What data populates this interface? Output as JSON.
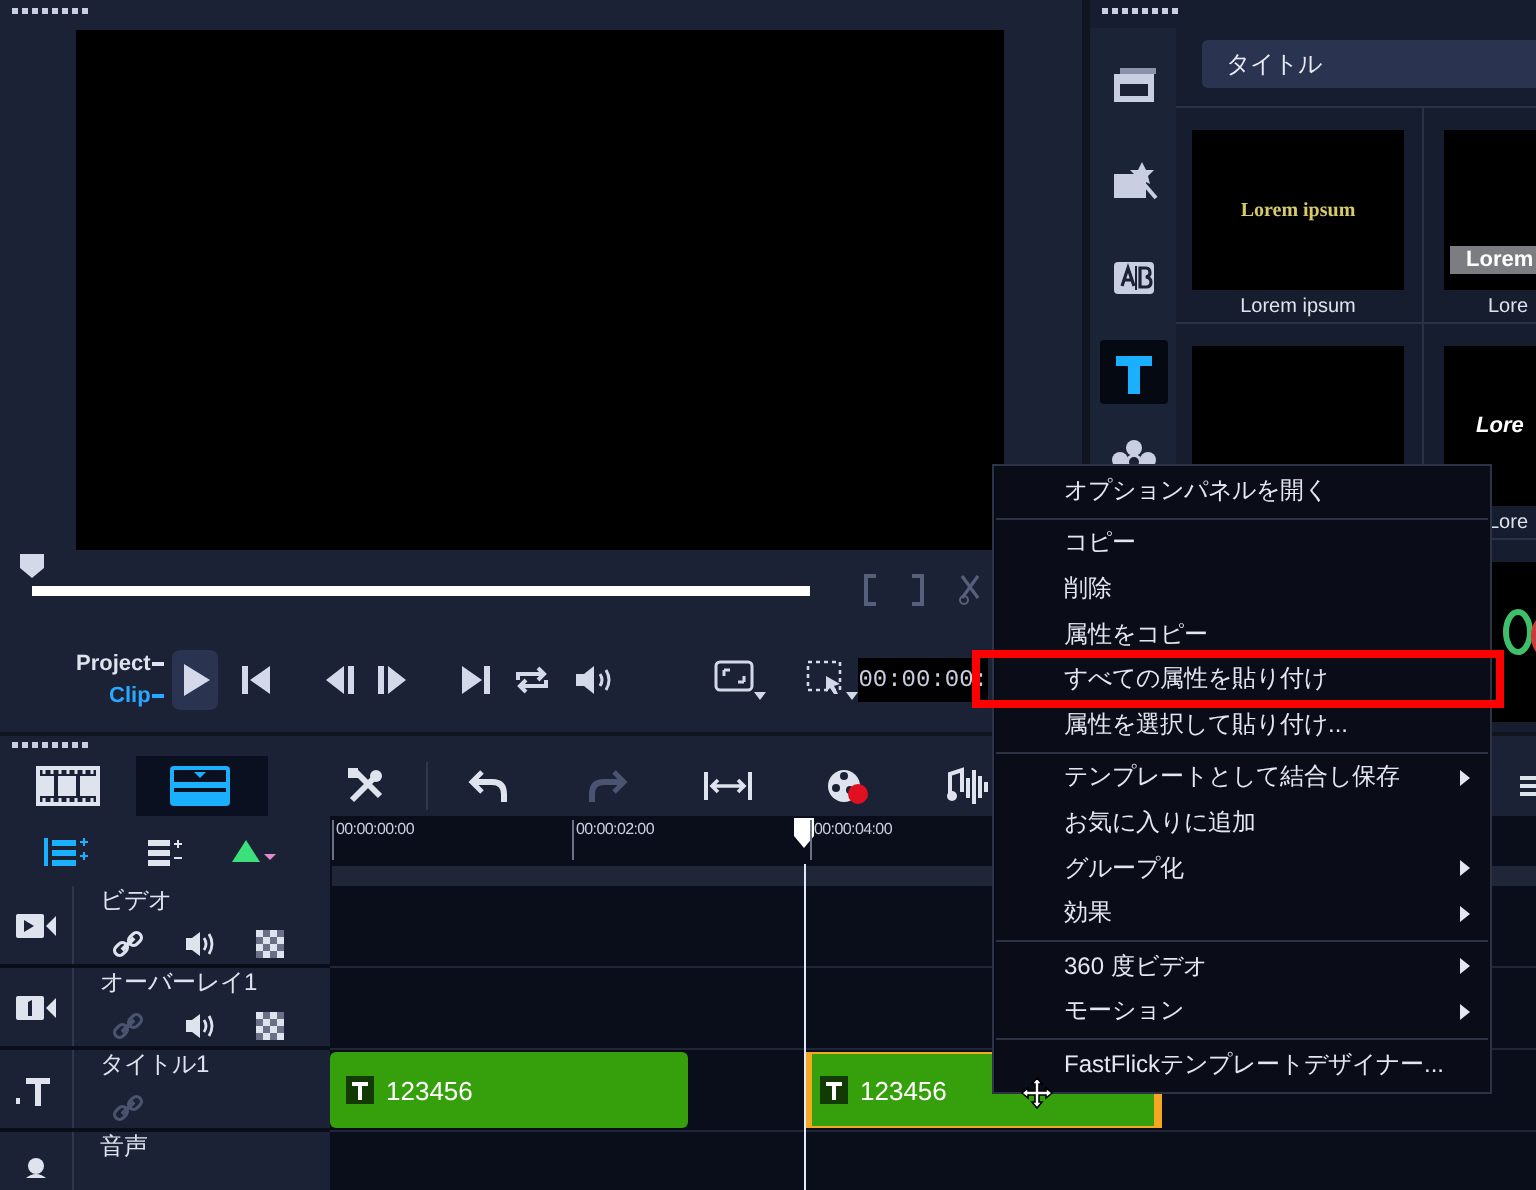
{
  "preview": {
    "project_label": "Project",
    "clip_label": "Clip",
    "scrub": {
      "level": 0
    },
    "timecode": "00:00:00:"
  },
  "library": {
    "tools": [
      {
        "kind": "media",
        "selected": false
      },
      {
        "kind": "effects",
        "selected": false
      },
      {
        "kind": "transition",
        "selected": false
      },
      {
        "kind": "title",
        "selected": true
      },
      {
        "kind": "graphics",
        "selected": false
      }
    ],
    "category": "タイトル",
    "thumbnails": [
      {
        "kind": "serif",
        "sample": "Lorem ipsum",
        "caption": "Lorem ipsum"
      },
      {
        "kind": "banner",
        "sample": "Lorem",
        "caption": "Lore"
      },
      {
        "kind": "bar"
      },
      {
        "kind": "italic",
        "sample": "Lore",
        "caption": "Lore"
      },
      {
        "kind": "ornament"
      }
    ]
  },
  "timeline": {
    "views": [
      {
        "kind": "timeline",
        "selected": false
      },
      {
        "kind": "storyboard",
        "selected": true
      }
    ],
    "ruler": [
      "00:00:00:00",
      "00:00:02:00",
      "00:00:04:00"
    ],
    "tracks": [
      {
        "kind": "video",
        "name": "ビデオ",
        "link_enabled": true
      },
      {
        "kind": "overlay",
        "name": "オーバーレイ1",
        "link_enabled": false
      },
      {
        "kind": "title",
        "name": "タイトル1",
        "link_enabled": false,
        "clips": [
          {
            "label": "123456",
            "selected": false
          },
          {
            "label": "123456",
            "selected": true
          }
        ]
      },
      {
        "kind": "audio",
        "name": "音声"
      }
    ]
  },
  "context_menu": {
    "items": [
      {
        "label": "オプションパネルを開く",
        "submenu": false,
        "highlighted": false
      },
      {
        "label": "コピー",
        "submenu": false,
        "highlighted": false,
        "divider_before": true
      },
      {
        "label": "削除",
        "submenu": false,
        "highlighted": false
      },
      {
        "label": "属性をコピー",
        "submenu": false,
        "highlighted": false
      },
      {
        "label": "すべての属性を貼り付け",
        "submenu": false,
        "highlighted": true
      },
      {
        "label": "属性を選択して貼り付け...",
        "submenu": false,
        "highlighted": false
      },
      {
        "label": "テンプレートとして結合し保存",
        "submenu": true,
        "highlighted": false,
        "divider_before": true
      },
      {
        "label": "お気に入りに追加",
        "submenu": false,
        "highlighted": false
      },
      {
        "label": "グループ化",
        "submenu": true,
        "highlighted": false
      },
      {
        "label": "効果",
        "submenu": true,
        "highlighted": false
      },
      {
        "label": "360 度ビデオ",
        "submenu": true,
        "highlighted": false,
        "divider_before": true
      },
      {
        "label": "モーション",
        "submenu": true,
        "highlighted": false
      },
      {
        "label": "FastFlickテンプレートデザイナー...",
        "submenu": false,
        "highlighted": false,
        "divider_before": true
      }
    ]
  }
}
